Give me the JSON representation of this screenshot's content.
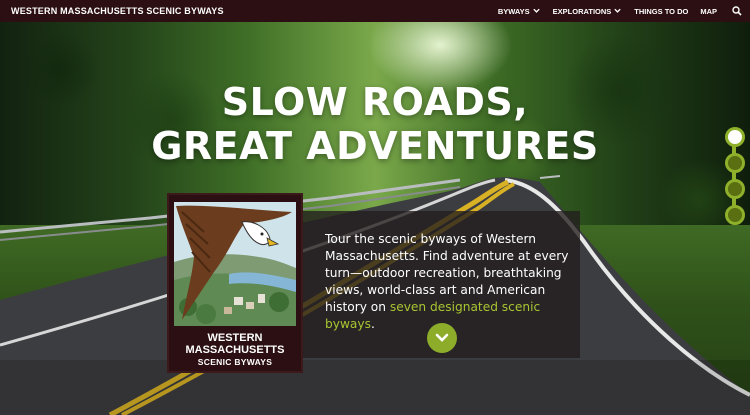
{
  "brand": "WESTERN MASSACHUSETTS SCENIC BYWAYS",
  "nav": {
    "items": [
      {
        "label": "BYWAYS",
        "dropdown": true
      },
      {
        "label": "EXPLORATIONS",
        "dropdown": true
      },
      {
        "label": "THINGS TO DO",
        "dropdown": false
      },
      {
        "label": "MAP",
        "dropdown": false
      }
    ],
    "search_icon": "search-icon"
  },
  "hero": {
    "headline_line1": "SLOW ROADS,",
    "headline_line2": "GREAT ADVENTURES",
    "intro_text": "Tour the scenic byways of Western Massachusetts. Find adventure at every turn—outdoor recreation, breathtaking views, world-class art and American history on",
    "intro_link": "seven designated scenic byways",
    "intro_end": ".",
    "scroll_icon": "chevron-down-icon"
  },
  "logo": {
    "line1": "WESTERN",
    "line2": "MASSACHUSETTS",
    "line3": "SCENIC BYWAYS"
  },
  "slider": {
    "count": 4,
    "active_index": 0
  },
  "colors": {
    "topbar": "#2b0f12",
    "accent_green": "#8cac2a",
    "link_green": "#a8c531",
    "panel_bg": "rgba(34,30,30,0.78)",
    "text": "#ffffff"
  }
}
